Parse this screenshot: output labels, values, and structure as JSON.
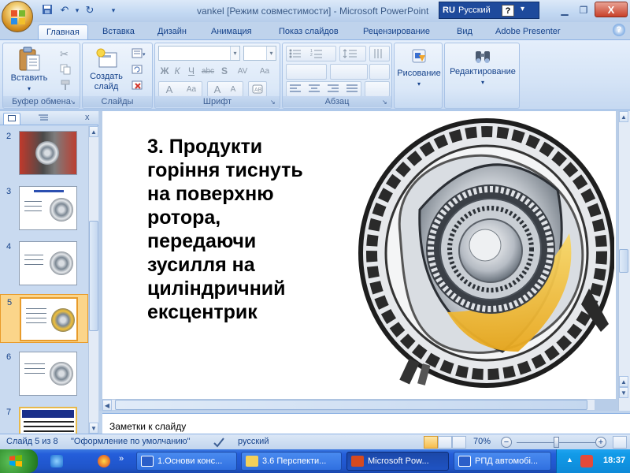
{
  "window": {
    "title": "vankel [Режим совместимости] - Microsoft PowerPoint",
    "lang_code": "RU",
    "lang_name": "Русский",
    "help_glyph": "?",
    "close_glyph": "X"
  },
  "tabs": [
    {
      "label": "Главная",
      "active": true
    },
    {
      "label": "Вставка"
    },
    {
      "label": "Дизайн"
    },
    {
      "label": "Анимация"
    },
    {
      "label": "Показ слайдов"
    },
    {
      "label": "Рецензирование"
    },
    {
      "label": "Вид"
    },
    {
      "label": "Adobe Presenter"
    }
  ],
  "ribbon": {
    "clipboard": {
      "group_label": "Буфер обмена",
      "paste_label": "Вставить"
    },
    "slides": {
      "group_label": "Слайды",
      "create_label_1": "Создать",
      "create_label_2": "слайд"
    },
    "font": {
      "group_label": "Шрифт",
      "bold": "Ж",
      "italic": "К",
      "underline": "Ч",
      "strike": "abc",
      "shadow": "S",
      "spacing": "AV",
      "case": "Aa",
      "grow": "A",
      "shrink": "A"
    },
    "paragraph": {
      "group_label": "Абзац"
    },
    "drawing": {
      "label": "Рисование"
    },
    "editing": {
      "label": "Редактирование"
    }
  },
  "slides_panel": {
    "thumbnails": [
      {
        "number": "2"
      },
      {
        "number": "3"
      },
      {
        "number": "4"
      },
      {
        "number": "5",
        "selected": true
      },
      {
        "number": "6"
      },
      {
        "number": "7"
      }
    ]
  },
  "slide": {
    "lines": [
      "3. Продукти",
      "горіння тиснуть",
      "на поверхню",
      "ротора,",
      "передаючи",
      "зусилля на",
      "циліндричний",
      "ексцентрик"
    ]
  },
  "notes": {
    "placeholder": "Заметки к слайду"
  },
  "status": {
    "slide_info": "Слайд 5 из 8",
    "theme": "\"Оформление по умолчанию\"",
    "language": "русский",
    "zoom": "70%",
    "zoom_fraction": 0.5
  },
  "taskbar": {
    "items": [
      {
        "label": "1.Основи конс..."
      },
      {
        "label": "3.6 Перспекти..."
      },
      {
        "label": "Microsoft Pow...",
        "active": true
      },
      {
        "label": "РПД автомобі..."
      }
    ],
    "clock": "18:37"
  },
  "colors": {
    "accent": "#15428b",
    "ribbon_bg": "#dbe8f8",
    "selected_thumb": "#fbd58a",
    "taskbar": "#245edb",
    "rotor_highlight": "#f2c13a"
  }
}
